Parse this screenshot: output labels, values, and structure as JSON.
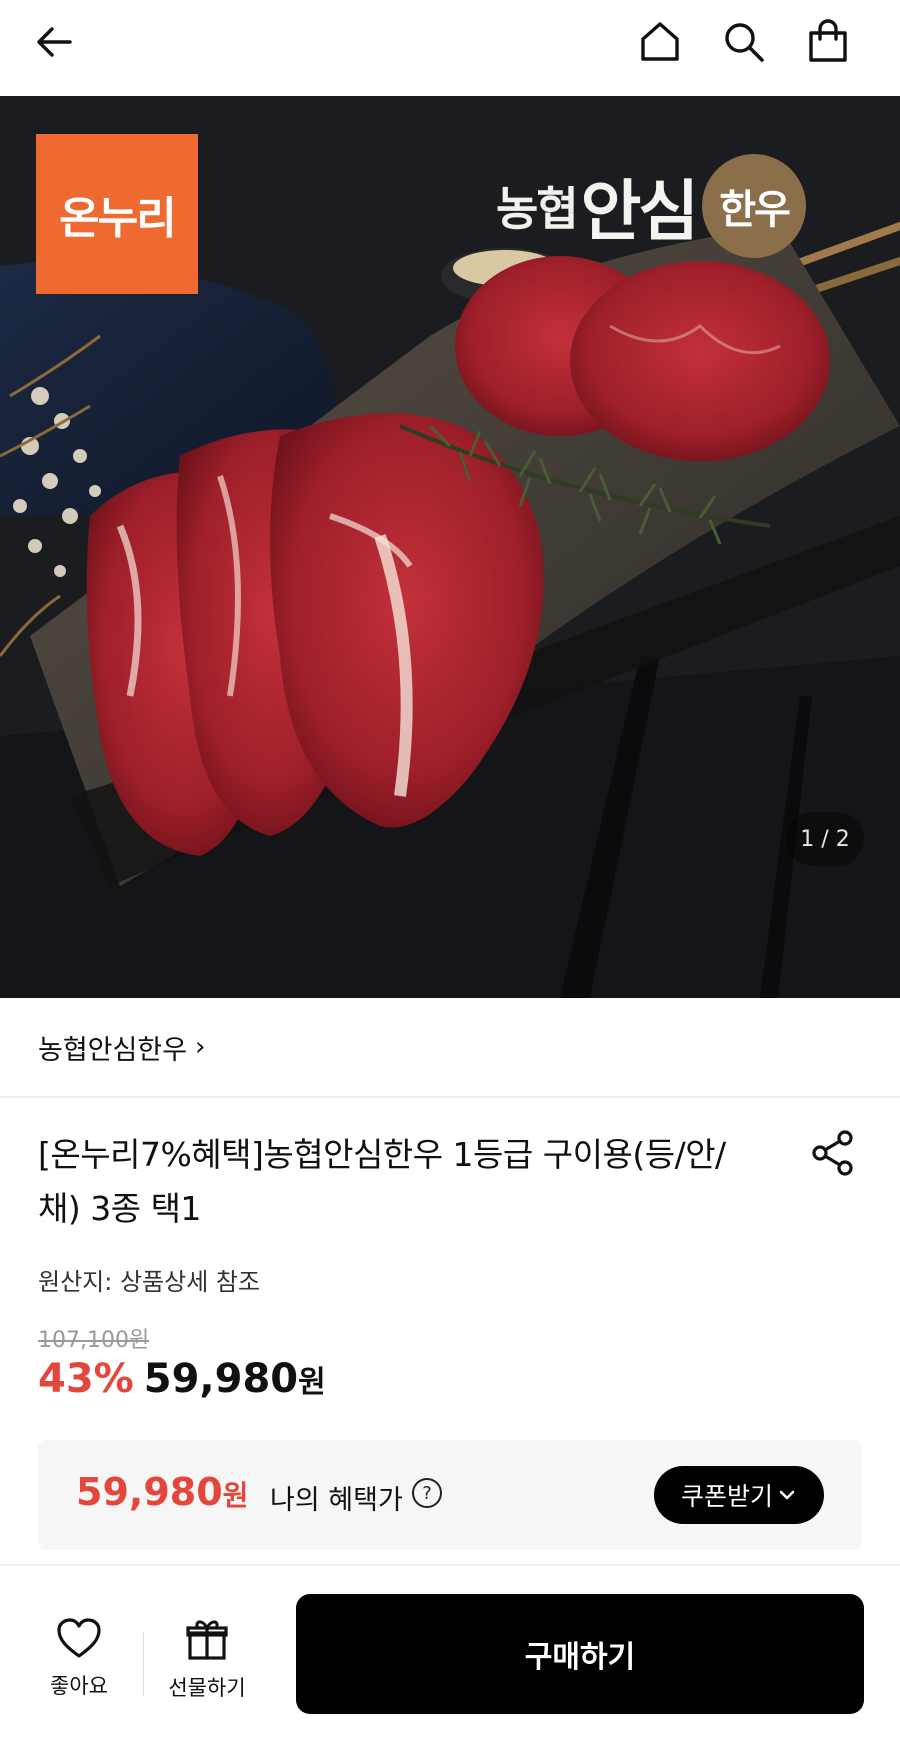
{
  "header": {
    "back_icon": "arrow-left-icon",
    "home_icon": "home-icon",
    "search_icon": "search-icon",
    "cart_icon": "shopping-bag-icon"
  },
  "hero": {
    "logo_left": "온누리",
    "logo_right_prefix": "농협",
    "logo_right_main": "안심",
    "logo_right_badge": "한우",
    "pager": "1 / 2"
  },
  "brand": {
    "name": "농협안심한우",
    "chevron": "›"
  },
  "product": {
    "title": "[온누리7%혜택]농협안심한우 1등급 구이용(등/안/채) 3종 택1",
    "origin": "원산지: 상품상세 참조",
    "original_price": "107,100원",
    "discount": "43%",
    "price": "59,980",
    "price_unit": "원"
  },
  "benefit": {
    "price": "59,980",
    "price_unit": "원",
    "label": "나의 혜택가",
    "help": "?",
    "coupon_button": "쿠폰받기"
  },
  "bottom_bar": {
    "like_label": "좋아요",
    "gift_label": "선물하기",
    "buy_label": "구매하기"
  },
  "colors": {
    "accent_red": "#e5463b",
    "onnuri_orange": "#ee6a30",
    "buy_button": "#000000",
    "benefit_bg": "#f6f6f6"
  }
}
